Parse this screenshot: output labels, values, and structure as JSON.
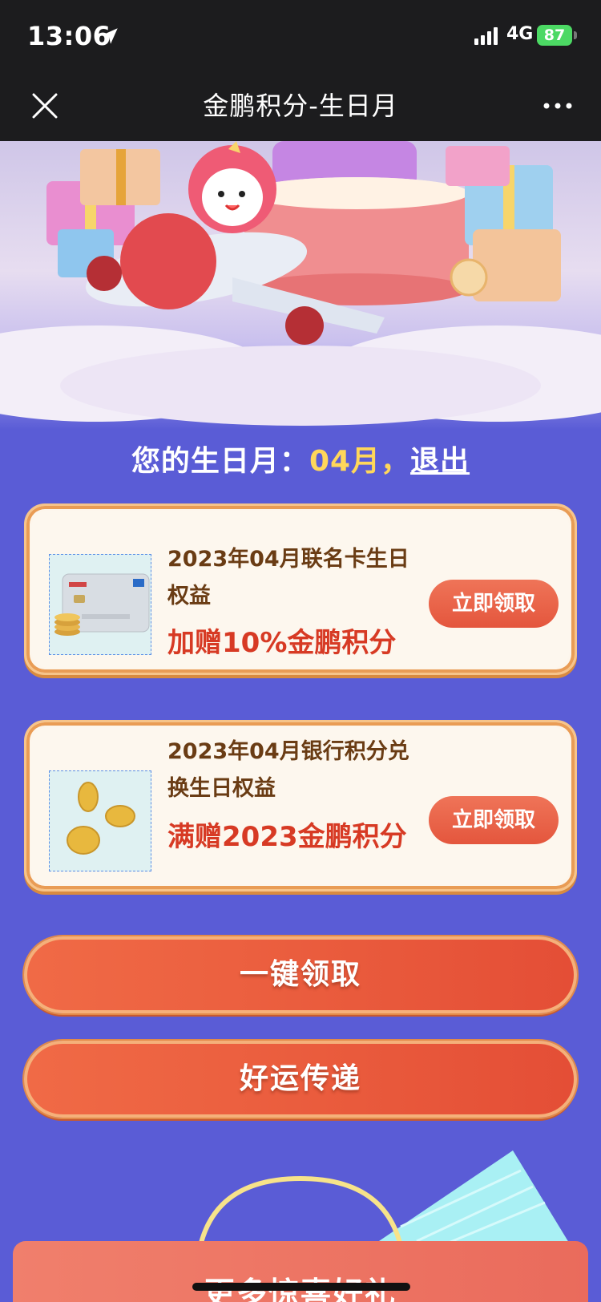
{
  "status": {
    "time": "13:06",
    "network": "4G",
    "battery": "87"
  },
  "nav": {
    "title": "金鹏积分-生日月",
    "close_icon": "close-icon",
    "more_icon": "more-icon"
  },
  "birthday": {
    "prefix": "您的生日月：",
    "month": "04月，",
    "logout": "退出"
  },
  "cards": [
    {
      "title": "2023年04月联名卡生日权益",
      "highlight": "加赠10%金鹏积分",
      "button": "立即领取",
      "thumb_icon": "credit-card-icon"
    },
    {
      "title": "2023年04月银行积分兑换生日权益",
      "highlight": "满赠2023金鹏积分",
      "button": "立即领取",
      "thumb_icon": "coins-icon"
    }
  ],
  "actions": {
    "claim_all": "一键领取",
    "share": "好运传递"
  },
  "bottom": {
    "title": "更多惊喜好礼"
  },
  "colors": {
    "background": "#5a5cd6",
    "month_highlight": "#ffd75a",
    "card_bg": "#fdf6ec",
    "button": "#e95a3c",
    "highlight_text": "#d73a24"
  }
}
